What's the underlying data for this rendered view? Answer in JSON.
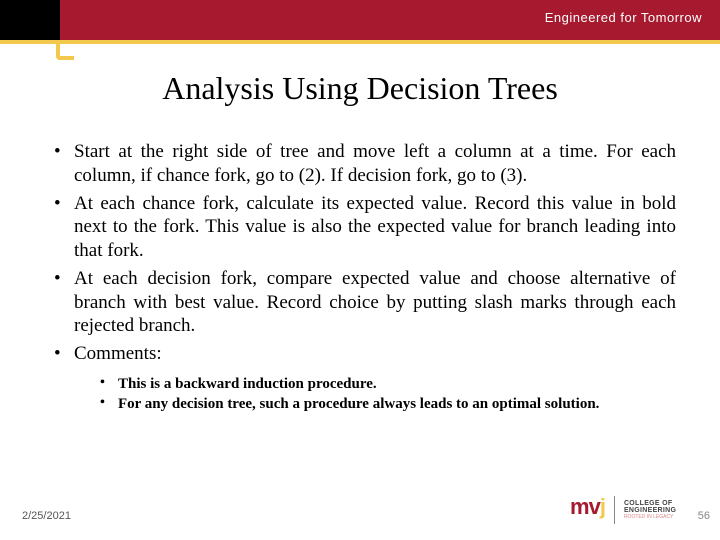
{
  "header": {
    "tagline": "Engineered for Tomorrow"
  },
  "title": "Analysis Using Decision Trees",
  "bullets": [
    "Start at the right side of tree and move left a column at a time. For each column, if chance fork, go to (2).  If decision fork, go to (3).",
    "At each chance fork, calculate its expected value.  Record this value in bold next to the fork.  This value is also the expected value for branch leading into that fork.",
    "At each decision fork, compare expected value and choose alternative of branch with best value.  Record choice by putting slash marks through each rejected branch.",
    "Comments:"
  ],
  "sub_bullets": [
    "This is a backward induction procedure.",
    "For any decision tree, such a procedure always leads to an optimal solution."
  ],
  "footer": {
    "date": "2/25/2021",
    "page": "56",
    "logo_text": {
      "m": "m",
      "v": "v",
      "j": "j",
      "coe_line1": "COLLEGE OF",
      "coe_line2": "ENGINEERING",
      "tagline": "ROOTED IN LEGACY"
    }
  }
}
